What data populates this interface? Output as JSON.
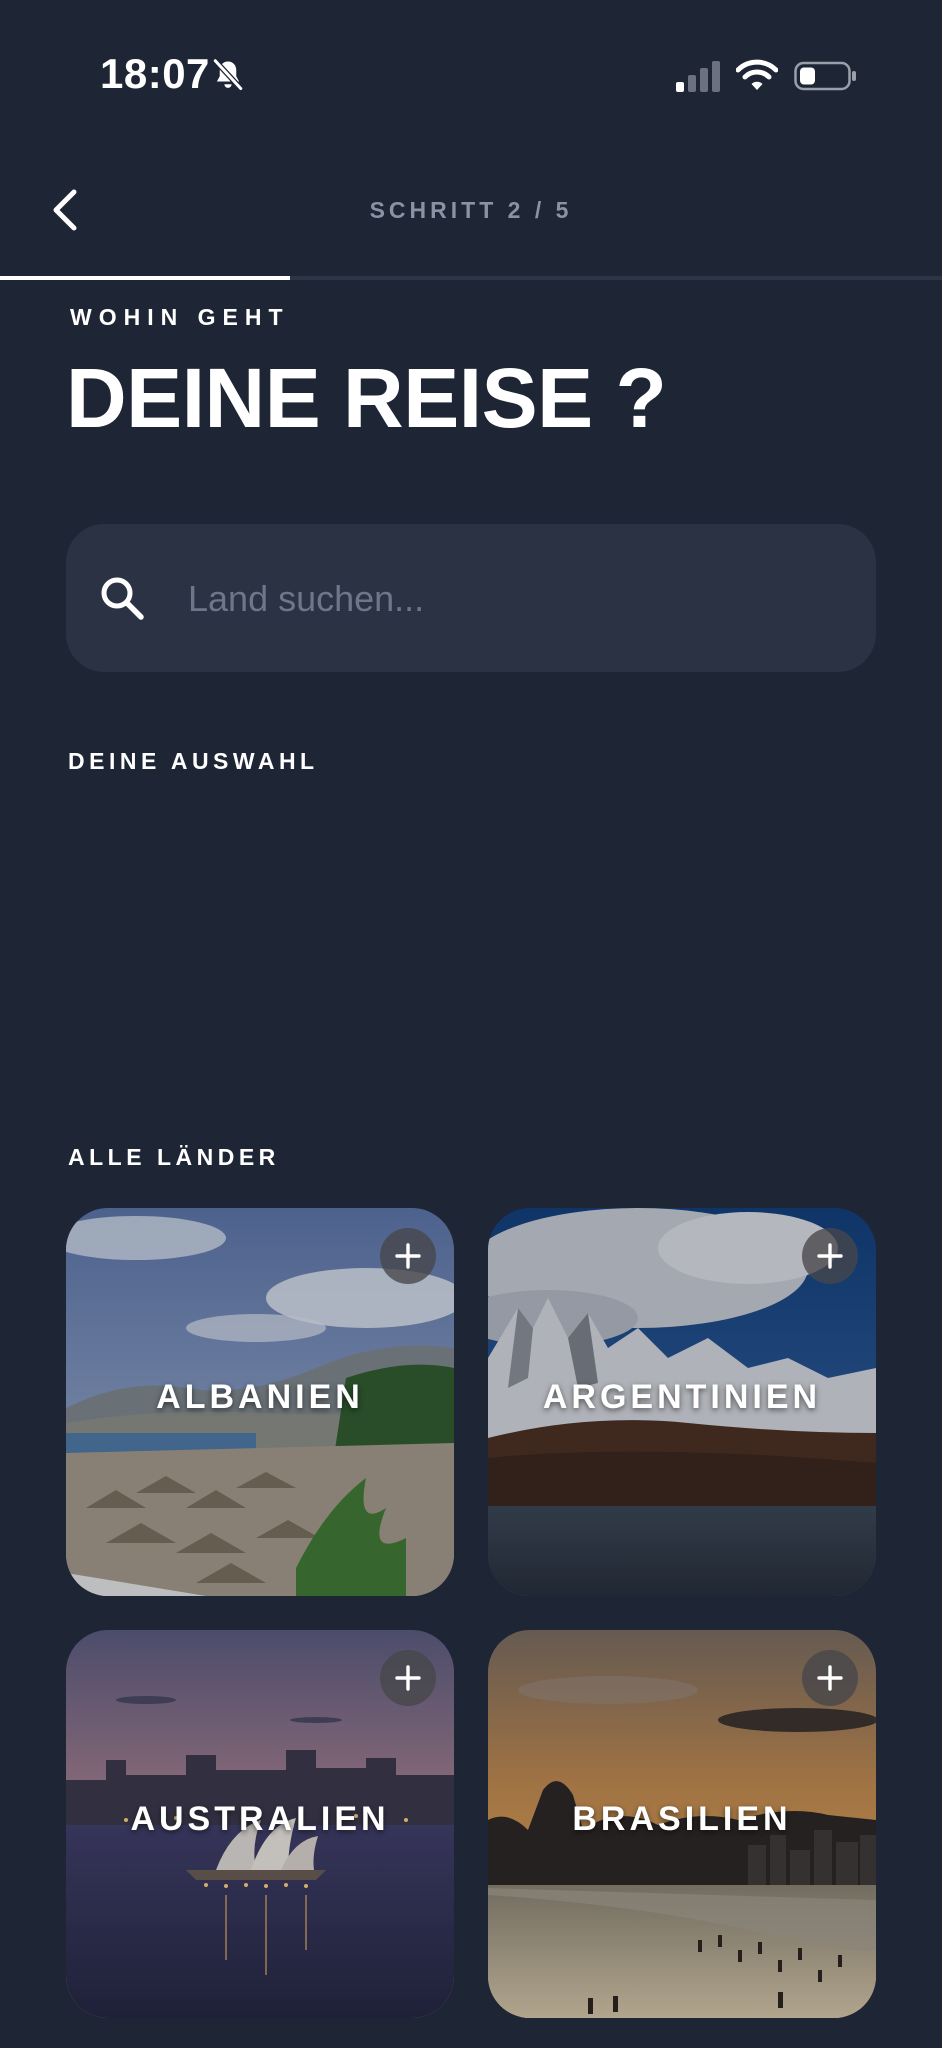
{
  "status_bar": {
    "time": "18:07",
    "icons": [
      "bell-slash-icon",
      "cellular-signal-icon",
      "wifi-icon",
      "battery-icon"
    ]
  },
  "header": {
    "back_icon": "chevron-left-icon",
    "step": "SCHRITT 2 / 5",
    "progress": 0.4
  },
  "heading": {
    "eyebrow": "WOHIN GEHT",
    "title": "DEINE REISE ?"
  },
  "search": {
    "icon": "search-icon",
    "placeholder": "Land suchen...",
    "value": ""
  },
  "selection": {
    "label": "DEINE AUSWAHL",
    "items": []
  },
  "countries": {
    "label": "ALLE LÄNDER",
    "items": [
      {
        "name": "ALBANIEN",
        "action_icon": "plus-icon"
      },
      {
        "name": "ARGENTINIEN",
        "action_icon": "plus-icon"
      },
      {
        "name": "AUSTRALIEN",
        "action_icon": "plus-icon"
      },
      {
        "name": "BRASILIEN",
        "action_icon": "plus-icon"
      }
    ]
  },
  "colors": {
    "background": "#1e2535",
    "surface": "#2a3243",
    "muted_text": "#8a93a3",
    "placeholder": "#6e778a",
    "accent": "#ffffff"
  }
}
